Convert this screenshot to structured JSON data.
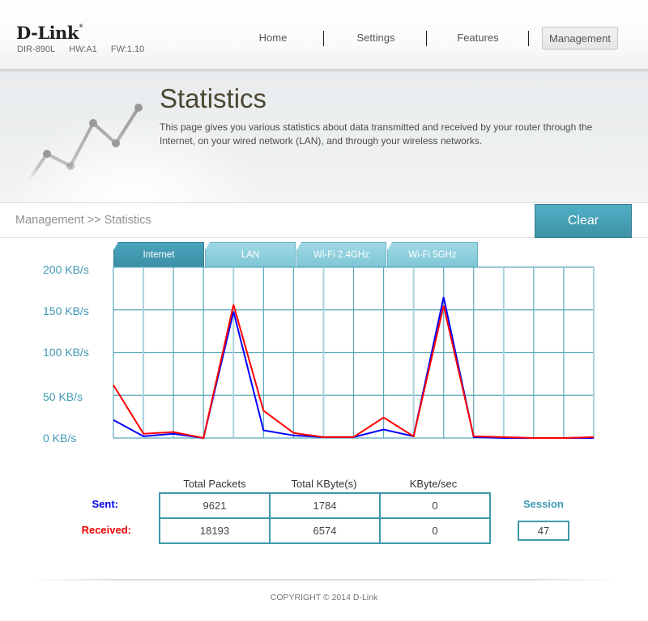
{
  "header": {
    "brand": "D-Link",
    "brand_mark": "®",
    "model": "DIR-890L",
    "hw": "HW:A1",
    "fw": "FW:1.10",
    "nav": [
      {
        "label": "Home",
        "active": false
      },
      {
        "label": "Settings",
        "active": false
      },
      {
        "label": "Features",
        "active": false
      },
      {
        "label": "Management",
        "active": true
      }
    ]
  },
  "hero": {
    "title": "Statistics",
    "description": "This page gives you various statistics about data transmitted and received by your router through the Internet, on your wired network (LAN), and through your wireless networks.",
    "icon": "line-chart-icon"
  },
  "breadcrumb": "Management >> Statistics",
  "clear_button": "Clear",
  "tabs": [
    {
      "label": "Internet",
      "active": true
    },
    {
      "label": "LAN",
      "active": false
    },
    {
      "label": "Wi-Fi 2.4GHz",
      "active": false
    },
    {
      "label": "Wi-Fi 5GHz",
      "active": false
    }
  ],
  "colors": {
    "accent": "#3f97ab",
    "sent": "#0000ff",
    "received": "#ff0000",
    "grid": "#5aa8bd"
  },
  "chart_data": {
    "type": "line",
    "title": "",
    "xlabel": "",
    "ylabel": "",
    "y_tick_labels": [
      "200 KB/s",
      "150 KB/s",
      "100 KB/s",
      "50 KB/s",
      "0 KB/s"
    ],
    "y_ticks": [
      200,
      150,
      100,
      50,
      0
    ],
    "ylim": [
      0,
      200
    ],
    "x": [
      0,
      1,
      2,
      3,
      4,
      5,
      6,
      7,
      8,
      9,
      10,
      11,
      12,
      13,
      14,
      15,
      16
    ],
    "grid": true,
    "legend": "none",
    "series": [
      {
        "name": "Sent",
        "color": "#0000ff",
        "values": [
          21,
          2,
          5,
          0,
          148,
          9,
          3,
          1,
          1,
          10,
          2,
          165,
          1,
          0,
          0,
          0,
          0
        ]
      },
      {
        "name": "Received",
        "color": "#ff0000",
        "values": [
          62,
          5,
          7,
          0,
          156,
          32,
          6,
          1,
          1,
          24,
          2,
          155,
          2,
          1,
          0,
          0,
          1
        ]
      }
    ]
  },
  "stats": {
    "columns": [
      "Total Packets",
      "Total KByte(s)",
      "KByte/sec"
    ],
    "rows": [
      {
        "label": "Sent:",
        "values": [
          "9621",
          "1784",
          "0"
        ]
      },
      {
        "label": "Received:",
        "values": [
          "18193",
          "6574",
          "0"
        ]
      }
    ],
    "session_label": "Session",
    "session_value": "47"
  },
  "footer": {
    "copyright": "COPYRIGHT © 2014 D-Link"
  }
}
